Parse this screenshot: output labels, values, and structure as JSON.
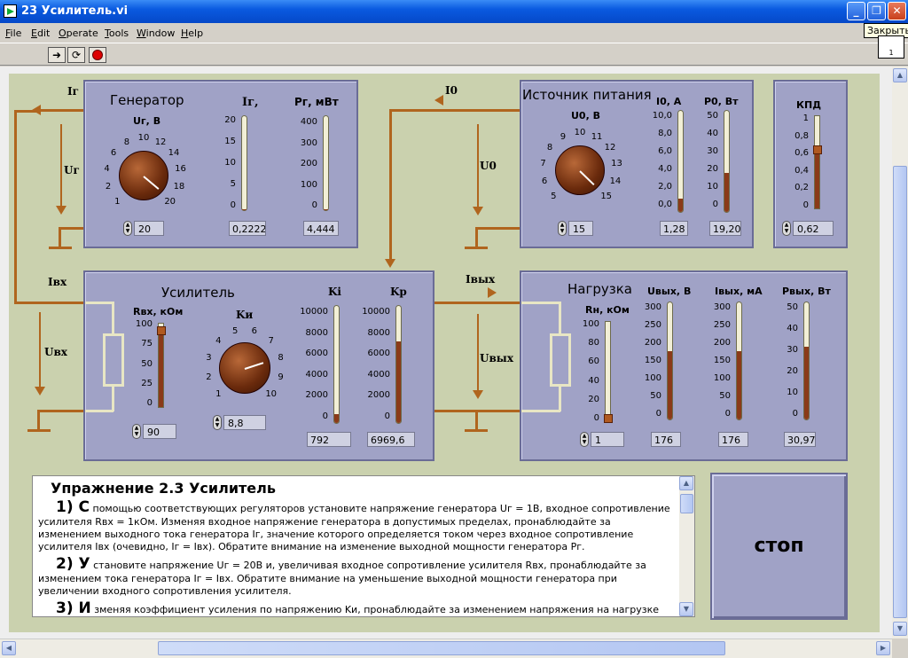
{
  "window": {
    "title": "23 Усилитель.vi",
    "tooltip": "Закрыть",
    "minimize": "_",
    "maximize": "❐",
    "close": "✕"
  },
  "menu": [
    "File",
    "Edit",
    "Operate",
    "Tools",
    "Window",
    "Help"
  ],
  "vi_icon_label": "1",
  "generator": {
    "title": "Генератор",
    "knob_label": "Uг, В",
    "knob_ticks": [
      "1",
      "2",
      "4",
      "6",
      "8",
      "10",
      "12",
      "14",
      "16",
      "18",
      "20"
    ],
    "knob_value": "20",
    "ig_label": "Iг,",
    "ig_ticks": [
      "20",
      "15",
      "10",
      "5",
      "0"
    ],
    "ig_value": "0,2222",
    "ig_fill": 0.011,
    "pg_label": "Pг, мВт",
    "pg_ticks": [
      "400",
      "300",
      "200",
      "100",
      "0"
    ],
    "pg_value": "4,444",
    "pg_fill": 0.011
  },
  "source": {
    "title": "Источник питания",
    "knob_label": "U0, В",
    "knob_ticks": [
      "5",
      "6",
      "7",
      "8",
      "9",
      "10",
      "11",
      "12",
      "13",
      "14",
      "15"
    ],
    "knob_value": "15",
    "i0_label": "I0, А",
    "i0_ticks": [
      "10,0",
      "8,0",
      "6,0",
      "4,0",
      "2,0",
      "0,0"
    ],
    "i0_value": "1,28",
    "i0_fill": 0.128,
    "p0_label": "P0, Вт",
    "p0_ticks": [
      "50",
      "40",
      "30",
      "20",
      "10",
      "0"
    ],
    "p0_value": "19,20",
    "p0_fill": 0.384
  },
  "kpd": {
    "title": "КПД",
    "ticks": [
      "1",
      "0,8",
      "0,6",
      "0,4",
      "0,2",
      "0"
    ],
    "value": "0,62",
    "fill": 0.62
  },
  "amplifier": {
    "title": "Усилитель",
    "rvx_label": "Rвх, кОм",
    "rvx_ticks": [
      "100",
      "75",
      "50",
      "25",
      "0"
    ],
    "rvx_value": "90",
    "rvx_fill": 0.9,
    "ku_label": "Kи",
    "ku_ticks": [
      "1",
      "2",
      "3",
      "4",
      "5",
      "6",
      "7",
      "8",
      "9",
      "10"
    ],
    "ku_value": "8,8",
    "ki_label": "Ki",
    "ki_ticks": [
      "10000",
      "8000",
      "6000",
      "4000",
      "2000",
      "0"
    ],
    "ki_value": "792",
    "ki_fill": 0.079,
    "kp_label": "Kp",
    "kp_ticks": [
      "10000",
      "8000",
      "6000",
      "4000",
      "2000",
      "0"
    ],
    "kp_value": "6969,6",
    "kp_fill": 0.697
  },
  "load": {
    "title": "Нагрузка",
    "rn_label": "Rн, кОм",
    "rn_ticks": [
      "100",
      "80",
      "60",
      "40",
      "20",
      "0"
    ],
    "rn_value": "1",
    "rn_fill": 0.01,
    "uvyx_label": "Uвых, В",
    "uvyx_ticks": [
      "300",
      "250",
      "200",
      "150",
      "100",
      "50",
      "0"
    ],
    "uvyx_value": "176",
    "uvyx_fill": 0.587,
    "ivyx_label": "Iвых, мА",
    "ivyx_ticks": [
      "300",
      "250",
      "200",
      "150",
      "100",
      "50",
      "0"
    ],
    "ivyx_value": "176",
    "ivyx_fill": 0.587,
    "pvyx_label": "Pвых, Вт",
    "pvyx_ticks": [
      "50",
      "40",
      "30",
      "20",
      "10",
      "0"
    ],
    "pvyx_value": "30,97",
    "pvyx_fill": 0.619
  },
  "wires": {
    "ig": "Iг",
    "ug": "Uг",
    "i0": "I0",
    "u0": "U0",
    "ivx": "Iвх",
    "uvx": "Uвх",
    "ivyx": "Iвых",
    "uvyx": "Uвых"
  },
  "text": {
    "title": "Упражнение 2.3 Усилитель",
    "p1_num": "1) С",
    "p1": "помощью соответствующих регуляторов установите напряжение генератора Uг = 1В, входное сопротивление усилителя Rвх = 1кОм. Изменяя входное напряжение генератора в допустимых пределах, пронаблюдайте за изменением выходного тока генератора Iг, значение которого определяется током через входное сопротивление усилителя Iвх (очевидно, Iг = Iвх). Обратите внимание на изменение выходной мощности генератора Pг.",
    "p2_num": "2) У",
    "p2": "становите напряжение Uг = 20В и, увеличивая входное сопротивление усилителя Rвх, пронаблюдайте за изменением тока генератора Iг = Iвх. Обратите внимание на уменьшение выходной мощности генератора при увеличении входного сопротивления усилителя.",
    "p3_num": "3) И",
    "p3": "зменяя коэффициент усиления по напряжению Kи, пронаблюдайте за изменением напряжения на нагрузке Uвых"
  },
  "stop_label": "стоп"
}
